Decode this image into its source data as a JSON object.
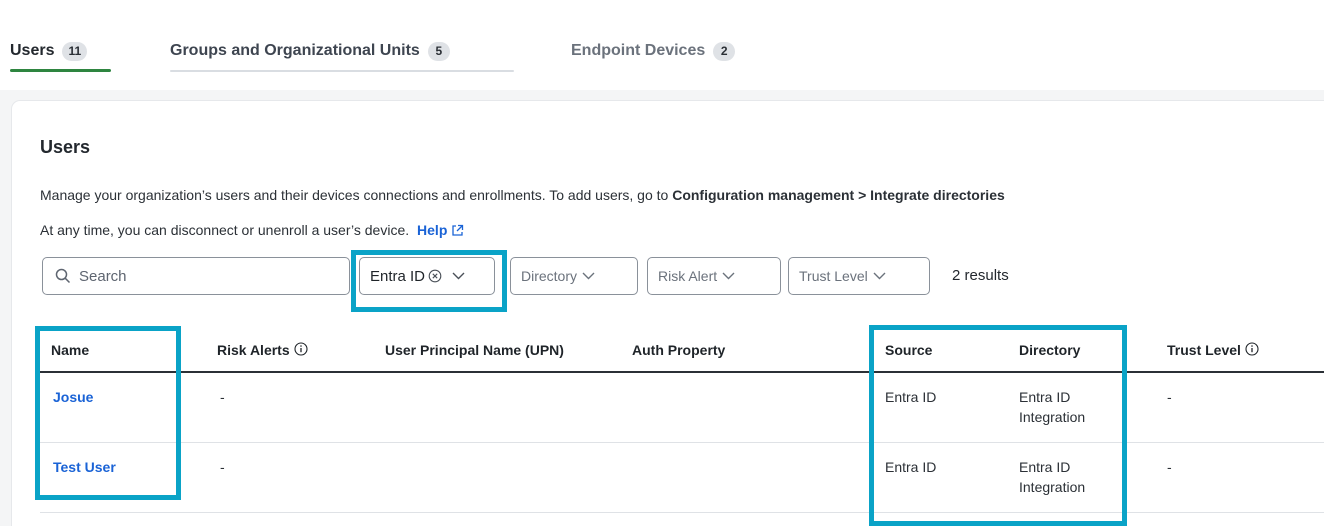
{
  "tabs": [
    {
      "label": "Users",
      "count": "11"
    },
    {
      "label": "Groups and Organizational Units",
      "count": "5"
    },
    {
      "label": "Endpoint Devices",
      "count": "2"
    }
  ],
  "card": {
    "title": "Users",
    "description_line1_prefix": "Manage your organization’s users and their devices connections and enrollments. To add users, go to ",
    "description_line1_bold": "Configuration management > Integrate directories",
    "description_line2": "At any time, you can disconnect or unenroll a user’s device.",
    "help_label": "Help"
  },
  "filters": {
    "search_placeholder": "Search",
    "source_selected": "Entra ID",
    "directory_label": "Directory",
    "risk_alert_label": "Risk Alert",
    "trust_level_label": "Trust Level",
    "results_text": "2 results"
  },
  "table": {
    "columns": {
      "name": "Name",
      "risk_alerts": "Risk Alerts",
      "upn": "User Principal Name (UPN)",
      "auth_property": "Auth Property",
      "source": "Source",
      "directory": "Directory",
      "trust_level": "Trust Level"
    },
    "rows": [
      {
        "name": "Josue",
        "risk_alerts": "-",
        "upn": "",
        "auth_property": "",
        "source": "Entra ID",
        "directory_line1": "Entra ID",
        "directory_line2": "Integration",
        "trust_level": "-"
      },
      {
        "name": "Test User",
        "risk_alerts": "-",
        "upn": "",
        "auth_property": "",
        "source": "Entra ID",
        "directory_line1": "Entra ID",
        "directory_line2": "Integration",
        "trust_level": "-"
      }
    ]
  },
  "colors": {
    "highlight": "#0aa3c7",
    "link": "#1a63d6",
    "active_tab_underline": "#2e8540"
  },
  "icons": [
    "search-icon",
    "clear-circle-icon",
    "chevron-down-icon",
    "external-link-icon",
    "info-icon"
  ]
}
